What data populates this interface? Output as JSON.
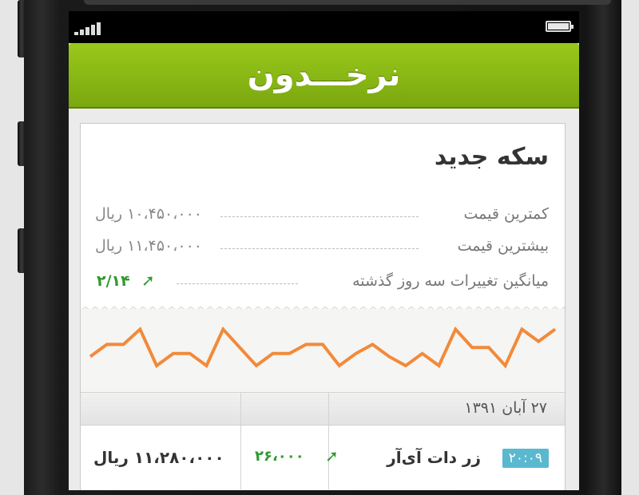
{
  "app": {
    "title": "نرخـــدون"
  },
  "status_bar": {
    "signal_bars": 5,
    "battery_level": 1.0
  },
  "card": {
    "title": "سکه جدید",
    "rows": [
      {
        "label": "کمترین قیمت",
        "value": "۱۰،۴۵۰،۰۰۰ ریال"
      },
      {
        "label": "بیشترین قیمت",
        "value": "۱۱،۴۵۰،۰۰۰ ریال"
      }
    ],
    "trend": {
      "label": "میانگین تغییرات سه روز گذشته",
      "value": "۲/۱۴",
      "direction": "up"
    }
  },
  "chart_data": {
    "type": "line",
    "color": "#f28a3a",
    "values": [
      4,
      6,
      6,
      8.5,
      2.5,
      4.5,
      4.5,
      2.5,
      8.5,
      5.5,
      2.5,
      4.5,
      4.5,
      6,
      6,
      2.5,
      4.5,
      6,
      4,
      2.5,
      4.5,
      2.5,
      8.5,
      5.5,
      5.5,
      2.5,
      8.5,
      6.5,
      8.5
    ]
  },
  "table": {
    "date_header": "۲۷ آبان ۱۳۹۱",
    "rows": [
      {
        "time": "۲۰:۰۹",
        "name": "زر دات آی‌آر",
        "change": "۲۶،۰۰۰",
        "change_direction": "up",
        "price": "۱۱،۲۸۰،۰۰۰ ریال"
      }
    ]
  },
  "colors": {
    "appbar": "#8ab815",
    "trend_up": "#2f9a2f",
    "time_badge": "#5ab8cf",
    "chart_line": "#f28a3a"
  }
}
